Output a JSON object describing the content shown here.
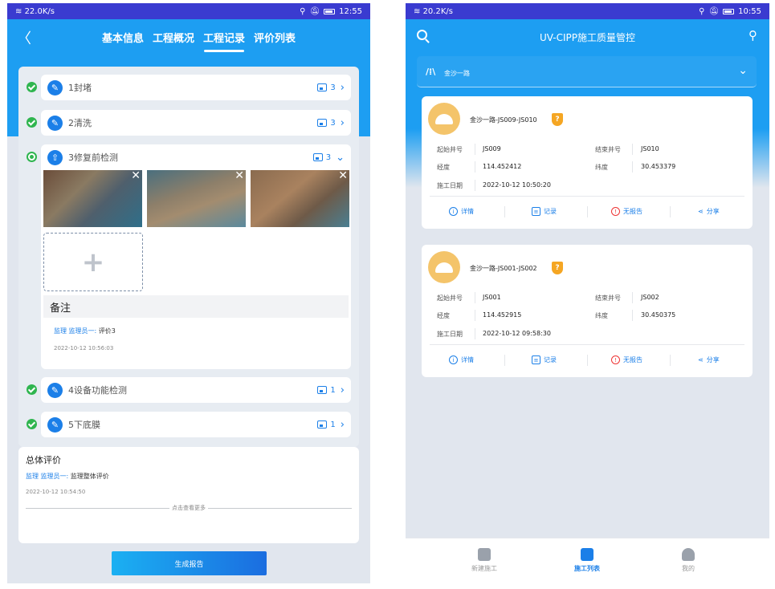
{
  "left": {
    "status": {
      "speed": "22.0K/s",
      "time": "12:55"
    },
    "tabs": [
      "基本信息",
      "工程概况",
      "工程记录",
      "评价列表"
    ],
    "steps": [
      {
        "label": "1封堵",
        "count": "3"
      },
      {
        "label": "2清洗",
        "count": "3"
      },
      {
        "label": "3修复前检测",
        "count": "3"
      },
      {
        "label": "4设备功能检测",
        "count": "1"
      },
      {
        "label": "5下底膜",
        "count": "1"
      }
    ],
    "remark_title": "备注",
    "comment": {
      "role": "监理 监理员一:",
      "text": "评价3",
      "time": "2022-10-12 10:56:03"
    },
    "overall": {
      "title": "总体评价",
      "role": "监理 监理员一:",
      "text": "监理整体评价",
      "time": "2022-10-12 10:54:50",
      "more": "点击查看更多"
    },
    "generate_button": "生成报告",
    "colors": {
      "primary": "#1d9ef2",
      "success": "#2fb54f"
    }
  },
  "right": {
    "status": {
      "speed": "20.2K/s",
      "time": "10:55"
    },
    "title": "UV-CIPP施工质量管控",
    "road": "金沙一路",
    "projects": [
      {
        "name": "金沙一路-JS009-JS010",
        "start_label": "起始井号",
        "start": "JS009",
        "end_label": "结束井号",
        "end": "JS010",
        "lng_label": "经度",
        "lng": "114.452412",
        "lat_label": "纬度",
        "lat": "30.453379",
        "date_label": "施工日期",
        "date": "2022-10-12 10:50:20"
      },
      {
        "name": "金沙一路-JS001-JS002",
        "start_label": "起始井号",
        "start": "JS001",
        "end_label": "结束井号",
        "end": "JS002",
        "lng_label": "经度",
        "lng": "114.452915",
        "lat_label": "纬度",
        "lat": "30.450375",
        "date_label": "施工日期",
        "date": "2022-10-12 09:58:30"
      }
    ],
    "actions": [
      "详情",
      "记录",
      "无报告",
      "分享"
    ],
    "nav": [
      "新建施工",
      "施工列表",
      "我的"
    ]
  }
}
